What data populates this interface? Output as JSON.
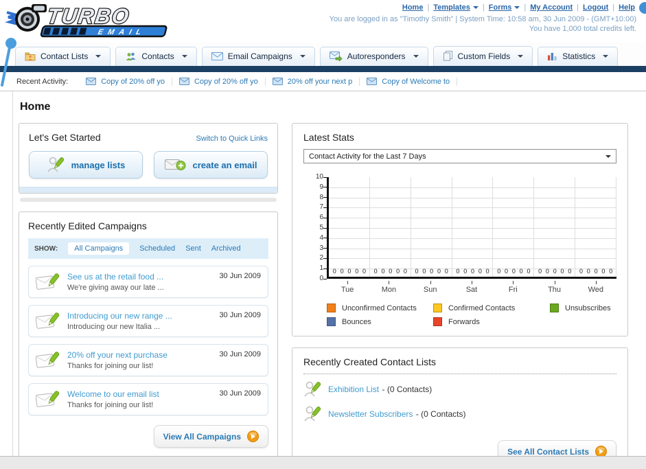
{
  "header": {
    "logo_title": "TURBO",
    "logo_subtitle": "EMAIL",
    "links": [
      {
        "label": "Home",
        "dropdown": false
      },
      {
        "label": "Templates",
        "dropdown": true
      },
      {
        "label": "Forms",
        "dropdown": true
      },
      {
        "label": "My Account",
        "dropdown": false
      },
      {
        "label": "Logout",
        "dropdown": false
      },
      {
        "label": "Help",
        "dropdown": false
      }
    ],
    "status_line1": "You are logged in as \"Timothy Smith\" | System Time: 10:58 am, 30 Jun 2009 - (GMT+10:00)",
    "status_line2": "You have 1,000 total credits left."
  },
  "nav_tabs": [
    {
      "label": "Contact Lists",
      "icon": "folder-user-icon"
    },
    {
      "label": "Contacts",
      "icon": "contacts-icon"
    },
    {
      "label": "Email Campaigns",
      "icon": "email-icon"
    },
    {
      "label": "Autoresponders",
      "icon": "autoresponder-icon"
    },
    {
      "label": "Custom Fields",
      "icon": "custom-fields-icon"
    },
    {
      "label": "Statistics",
      "icon": "statistics-icon"
    }
  ],
  "recent_activity": {
    "label": "Recent Activity:",
    "items": [
      {
        "label": "Copy of 20% off yo"
      },
      {
        "label": "Copy of 20% off yo"
      },
      {
        "label": "20% off your next p"
      },
      {
        "label": "Copy of Welcome to"
      }
    ]
  },
  "page_title": "Home",
  "get_started": {
    "title": "Let's Get Started",
    "switch_link": "Switch to Quick Links",
    "buttons": [
      {
        "label": "manage lists",
        "icon": "person-pencil-icon"
      },
      {
        "label": "create an email",
        "icon": "email-plus-icon"
      }
    ]
  },
  "campaigns": {
    "title": "Recently Edited Campaigns",
    "show_label": "SHOW:",
    "filters": [
      {
        "label": "All Campaigns",
        "active": true
      },
      {
        "label": "Scheduled",
        "active": false
      },
      {
        "label": "Sent",
        "active": false
      },
      {
        "label": "Archived",
        "active": false
      }
    ],
    "items": [
      {
        "title": "See us at the retail food ...",
        "subtitle": "We're giving away our late ...",
        "date": "30 Jun 2009"
      },
      {
        "title": "Introducing our new range ...",
        "subtitle": "Introducing our new Italia ...",
        "date": "30 Jun 2009"
      },
      {
        "title": "20% off your next purchase",
        "subtitle": "Thanks for joining our list!",
        "date": "30 Jun 2009"
      },
      {
        "title": "Welcome to our email list",
        "subtitle": "Thanks for joining our list!",
        "date": "30 Jun 2009"
      }
    ],
    "view_all_label": "View All Campaigns"
  },
  "latest_stats": {
    "title": "Latest Stats",
    "dropdown_value": "Contact Activity for the Last 7 Days"
  },
  "chart_data": {
    "type": "bar",
    "title": "Contact Activity for the Last 7 Days",
    "categories": [
      "Tue",
      "Mon",
      "Sun",
      "Sat",
      "Fri",
      "Thu",
      "Wed"
    ],
    "series": [
      {
        "name": "Unconfirmed Contacts",
        "color": "#f08019",
        "values": [
          0,
          0,
          0,
          0,
          0,
          0,
          0
        ]
      },
      {
        "name": "Confirmed Contacts",
        "color": "#fdc722",
        "values": [
          0,
          0,
          0,
          0,
          0,
          0,
          0
        ]
      },
      {
        "name": "Unsubscribes",
        "color": "#6aa81e",
        "values": [
          0,
          0,
          0,
          0,
          0,
          0,
          0
        ]
      },
      {
        "name": "Bounces",
        "color": "#5572a7",
        "values": [
          0,
          0,
          0,
          0,
          0,
          0,
          0
        ]
      },
      {
        "name": "Forwards",
        "color": "#e8442a",
        "values": [
          0,
          0,
          0,
          0,
          0,
          0,
          0
        ]
      }
    ],
    "ylim": [
      0,
      10
    ],
    "yticks": [
      0,
      1,
      2,
      3,
      4,
      5,
      6,
      7,
      8,
      9,
      10
    ],
    "grid": true,
    "legend_position": "bottom",
    "data_labels": "0"
  },
  "contact_lists": {
    "title": "Recently Created Contact Lists",
    "items": [
      {
        "name": "Exhibition List",
        "detail": "- (0 Contacts)"
      },
      {
        "name": "Newsletter Subscribers",
        "detail": "- (0 Contacts)"
      }
    ],
    "see_all_label": "See All Contact Lists"
  }
}
